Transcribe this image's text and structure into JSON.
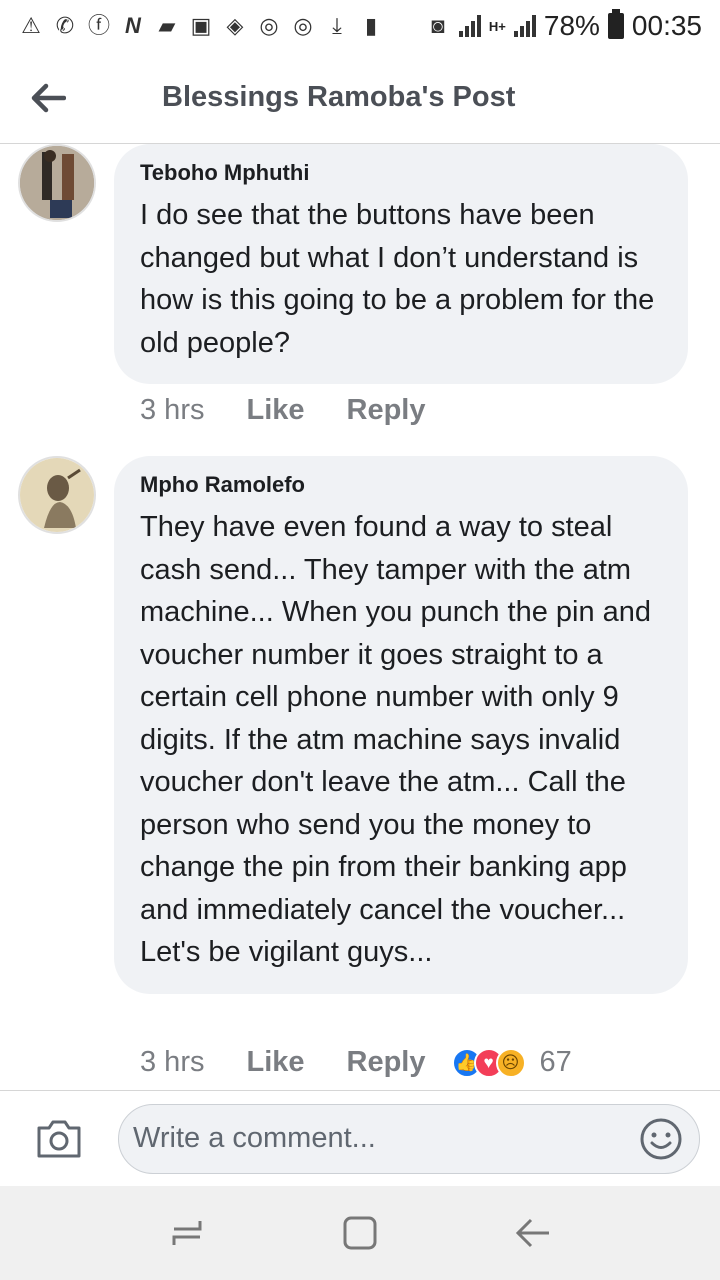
{
  "status_bar": {
    "battery_percent": "78%",
    "time": "00:35",
    "network": "H+",
    "left_icons": [
      "alert-icon",
      "whatsapp-icon",
      "facebook-icon",
      "n-icon",
      "gallery-icon",
      "image-icon",
      "wifi-icon",
      "sync-icon",
      "sync-icon-2",
      "download-icon",
      "sim-icon"
    ],
    "right_icons": [
      "storage-icon",
      "signal-icon",
      "network-type-icon",
      "signal-icon-2",
      "battery-icon"
    ]
  },
  "header": {
    "title": "Blessings Ramoba's Post",
    "back_icon": "arrow-left-icon"
  },
  "comments": [
    {
      "author": "Teboho Mphuthi",
      "text": "I do see that the buttons have been changed but what I don’t understand is how is this going to be a problem for the old people?",
      "time": "3 hrs",
      "like_label": "Like",
      "reply_label": "Reply"
    },
    {
      "author": "Mpho Ramolefo",
      "text": "They have even found a way to steal cash send... They tamper with the atm machine... When you punch the pin and voucher number it goes straight to a certain cell phone number with only 9 digits. If the atm machine says invalid voucher don't leave the atm... Call the person who send you the money to change the pin from their banking app and immediately cancel the voucher... Let's be vigilant guys...",
      "time": "3 hrs",
      "like_label": "Like",
      "reply_label": "Reply",
      "reactions": [
        "like-reaction-icon",
        "love-reaction-icon",
        "sad-reaction-icon"
      ],
      "reaction_count": "67"
    }
  ],
  "composer": {
    "placeholder": "Write a comment...",
    "camera_icon": "camera-icon",
    "emoji_icon": "smiley-icon"
  },
  "nav_bar": {
    "icons": [
      "recents-icon",
      "home-icon",
      "back-icon"
    ]
  },
  "colors": {
    "bubble_bg": "#f0f2f5",
    "meta_text": "#7a7d82",
    "like_blue": "#1877f2",
    "love_red": "#f33e58",
    "sad_yellow": "#f7b125"
  }
}
